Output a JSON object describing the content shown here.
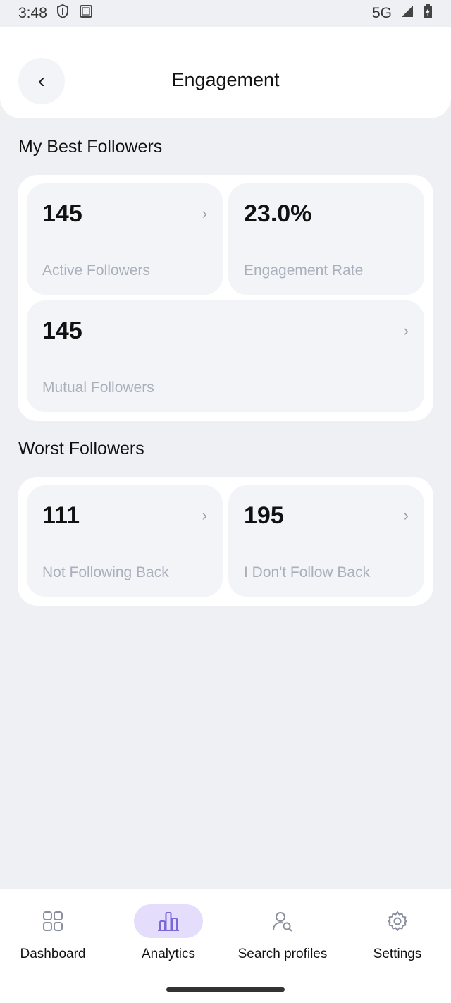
{
  "status_bar": {
    "time": "3:48",
    "network": "5G",
    "icons": [
      "shield-icon",
      "screen-icon",
      "signal-icon",
      "battery-charging-icon"
    ]
  },
  "header": {
    "back_label": "‹",
    "title": "Engagement"
  },
  "best_followers": {
    "title": "My Best Followers",
    "cards": [
      {
        "value": "145",
        "label": "Active Followers",
        "chevron": "›"
      },
      {
        "value": "23.0%",
        "label": "Engagement Rate"
      },
      {
        "value": "145",
        "label": "Mutual Followers",
        "chevron": "›"
      }
    ]
  },
  "worst_followers": {
    "title": "Worst Followers",
    "cards": [
      {
        "value": "111",
        "label": "Not Following Back",
        "chevron": "›"
      },
      {
        "value": "195",
        "label": "I Don't Follow Back",
        "chevron": "›"
      }
    ]
  },
  "bottom_nav": {
    "active": "Analytics",
    "items": [
      {
        "label": "Dashboard",
        "icon": "grid-icon"
      },
      {
        "label": "Analytics",
        "icon": "bar-chart-icon"
      },
      {
        "label": "Search profiles",
        "icon": "user-search-icon"
      },
      {
        "label": "Settings",
        "icon": "gear-icon"
      }
    ]
  },
  "colors": {
    "background": "#eef0f4",
    "card": "#f2f4f8",
    "accent": "#7b68d8",
    "active_pill": "#e4defc",
    "muted_text": "#aab0bb"
  }
}
